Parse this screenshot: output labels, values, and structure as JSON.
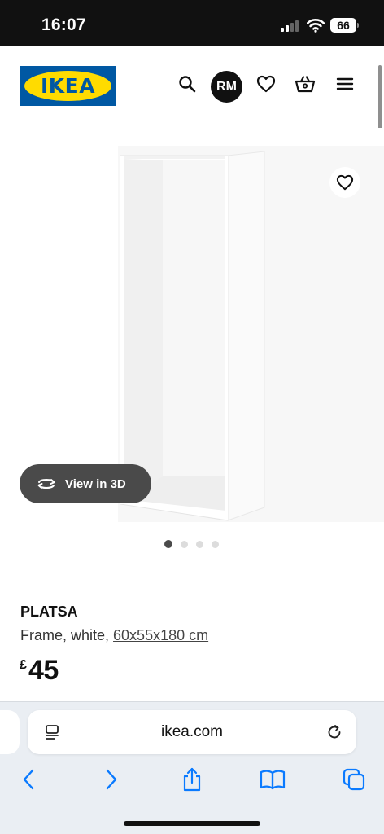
{
  "status_bar": {
    "time": "16:07",
    "battery": "66"
  },
  "header": {
    "logo_text": "IKEA",
    "avatar_initials": "RM",
    "icons": [
      "search-icon",
      "heart-icon",
      "basket-icon",
      "menu-icon"
    ]
  },
  "gallery": {
    "view_3d_label": "View in 3D",
    "image_count": 4,
    "active_image_index": 0
  },
  "product": {
    "name": "PLATSA",
    "description": "Frame, white, ",
    "dimensions": "60x55x180 cm",
    "price_currency": "£",
    "price_value": "45"
  },
  "browser": {
    "url": "ikea.com"
  },
  "colors": {
    "ikea_blue": "#0058a3",
    "ikea_yellow": "#ffdb00",
    "ios_blue": "#0a7aff"
  }
}
